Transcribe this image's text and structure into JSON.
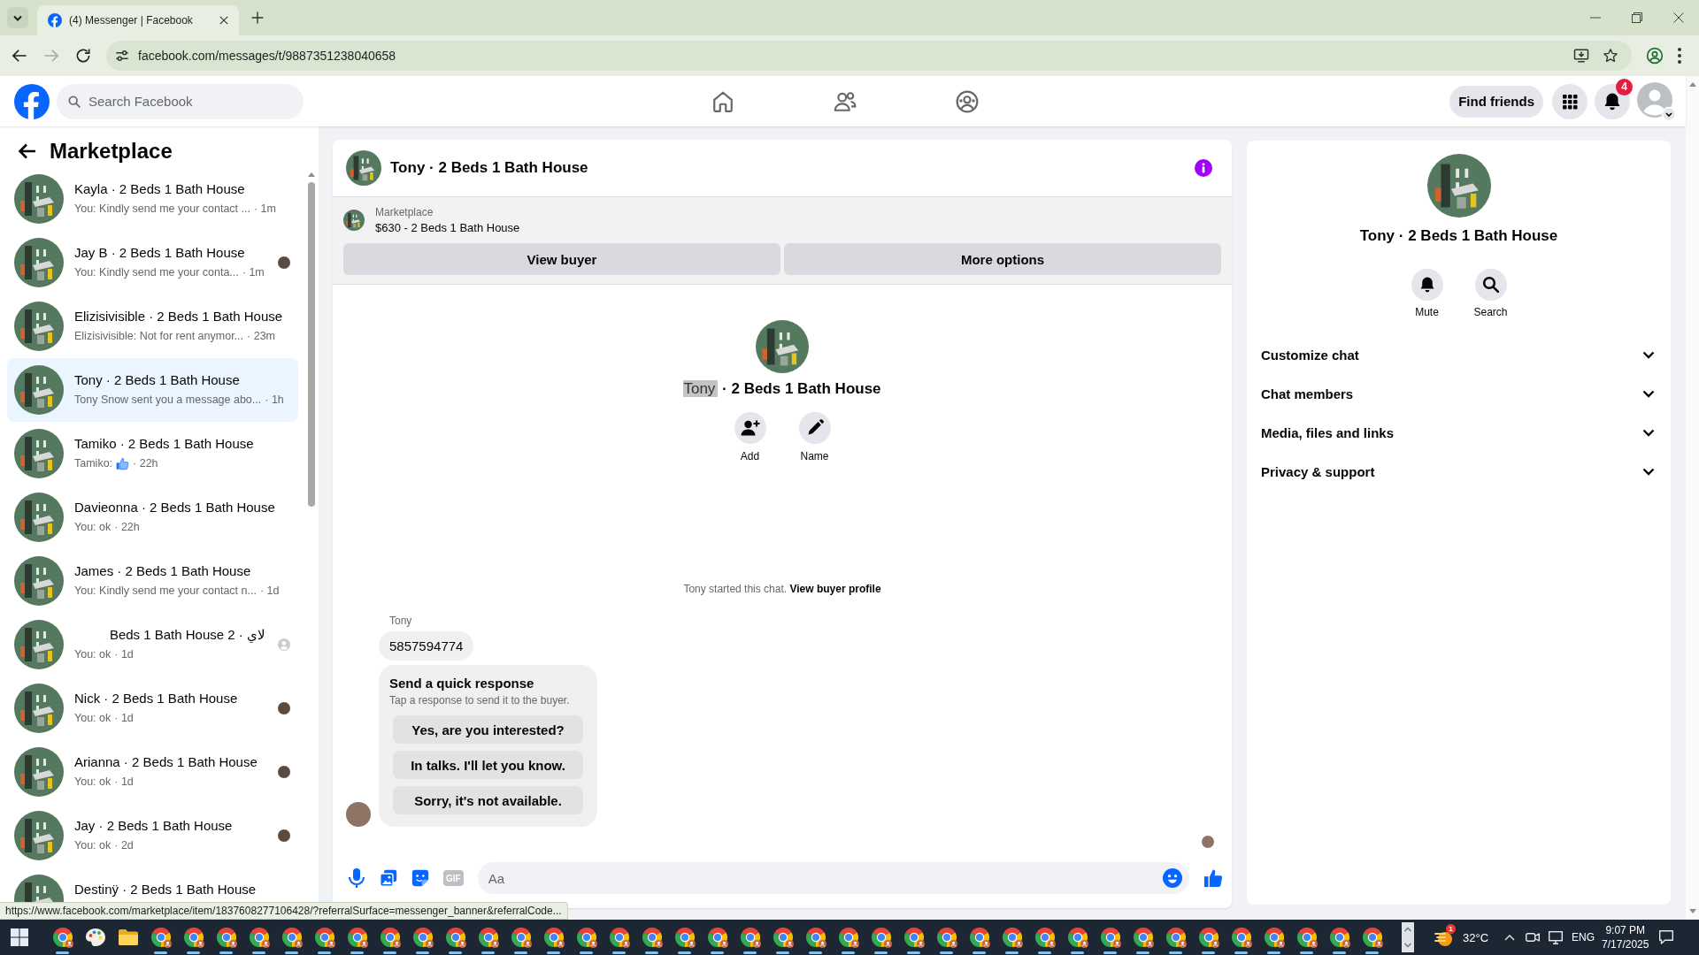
{
  "browser": {
    "tabs": [
      {
        "title": "(4) Messenger | Facebook",
        "selected": true
      }
    ],
    "nav_buttons": [
      {
        "kind": "back",
        "disabled": false
      },
      {
        "kind": "forward",
        "disabled": true
      },
      {
        "kind": "reload",
        "disabled": false
      }
    ],
    "url": "facebook.com/messages/t/9887351238040658",
    "status_url": "https://www.facebook.com/marketplace/item/1837608277106428/?referralSurface=messenger_banner&referralCode..."
  },
  "header": {
    "search": {
      "placeholder": "Search Facebook"
    },
    "nav": [
      {
        "kind": "home",
        "selected": false
      },
      {
        "kind": "friends",
        "selected": false
      },
      {
        "kind": "groups",
        "selected": false
      }
    ],
    "find_friends": "Find friends",
    "notification_count": "4"
  },
  "sidebar": {
    "title": "Marketplace",
    "conversations": [
      {
        "name": "Kayla · 2 Beds 1 Bath House",
        "kind": "text",
        "preview": "You: Kindly send me your contact ...",
        "time": "· 1m",
        "selected": false
      },
      {
        "name": "Jay B · 2 Beds 1 Bath House",
        "kind": "text",
        "preview": "You: Kindly send me your conta...",
        "time": "· 1m",
        "selected": false,
        "receipt": {
          "kind": "photo"
        }
      },
      {
        "name": "Elizisivisible · 2 Beds 1 Bath House",
        "kind": "text",
        "preview": "Elizisivisible: Not for rent anymor...",
        "time": "· 23m",
        "selected": false
      },
      {
        "name": "Tony · 2 Beds 1 Bath House",
        "kind": "text",
        "preview": "Tony Snow sent you a message abo...",
        "time": "· 1h",
        "selected": true
      },
      {
        "name": "Tamiko · 2 Beds 1 Bath House",
        "kind": "like",
        "preview": "Tamiko:",
        "time": "· 22h",
        "selected": false
      },
      {
        "name": "Davieonna · 2 Beds 1 Bath House",
        "kind": "text",
        "preview": "You: ok",
        "time": "· 22h",
        "selected": false
      },
      {
        "name": "James · 2 Beds 1 Bath House",
        "kind": "text",
        "preview": "You: Kindly send me your contact n...",
        "time": "· 1d",
        "selected": false
      },
      {
        "name": "لاي · 2 Beds 1 Bath House",
        "kind": "text",
        "preview": "You: ok",
        "time": "· 1d",
        "selected": false,
        "receipt": {
          "kind": "silhouette"
        }
      },
      {
        "name": "Nick · 2 Beds 1 Bath House",
        "kind": "text",
        "preview": "You: ok",
        "time": "· 1d",
        "selected": false,
        "receipt": {
          "kind": "photo"
        }
      },
      {
        "name": "Arianna · 2 Beds 1 Bath House",
        "kind": "text",
        "preview": "You: ok",
        "time": "· 1d",
        "selected": false,
        "receipt": {
          "kind": "photo"
        }
      },
      {
        "name": "Jay · 2 Beds 1 Bath House",
        "kind": "text",
        "preview": "You: ok",
        "time": "· 2d",
        "selected": false,
        "receipt": {
          "kind": "photo"
        }
      },
      {
        "name": "Destinÿ · 2 Beds 1 Bath House",
        "kind": "text",
        "selected": false
      }
    ]
  },
  "chat": {
    "title": "Tony · 2 Beds 1 Bath House",
    "listing": {
      "label": "Marketplace",
      "title": "$630 - 2 Beds 1 Bath House",
      "buttons": [
        "View buyer",
        "More options"
      ]
    },
    "profile": {
      "title_parts": [
        {
          "text": "Tony",
          "selected": true
        },
        {
          "text": "· 2 Beds 1 Bath House",
          "selected": false
        }
      ],
      "actions": [
        {
          "kind": "add",
          "label": "Add"
        },
        {
          "kind": "name",
          "label": "Name"
        }
      ]
    },
    "notice": {
      "text": "Tony started this chat.",
      "link": "View buyer profile"
    },
    "messages": [
      {
        "sender": "Tony",
        "text": "5857594774"
      }
    ],
    "quick_response": {
      "title": "Send a quick response",
      "subtitle": "Tap a response to send it to the buyer.",
      "options": [
        "Yes, are you interested?",
        "In talks. I'll let you know.",
        "Sorry, it's not available."
      ]
    },
    "composer": {
      "gif_label": "GIF",
      "placeholder": "Aa"
    }
  },
  "details": {
    "title": "Tony · 2 Beds 1 Bath House",
    "actions": [
      {
        "kind": "mute",
        "label": "Mute"
      },
      {
        "kind": "search",
        "label": "Search"
      }
    ],
    "sections": [
      {
        "label": "Customize chat",
        "expanded": false
      },
      {
        "label": "Chat members",
        "expanded": false
      },
      {
        "label": "Media, files and links",
        "expanded": false
      },
      {
        "label": "Privacy & support",
        "expanded": false
      }
    ]
  },
  "taskbar": {
    "apps": [
      {
        "kind": "browser",
        "running": true
      },
      {
        "kind": "palette",
        "running": false
      },
      {
        "kind": "folder",
        "running": false
      },
      {
        "kind": "browser",
        "running": true
      },
      {
        "kind": "browser",
        "running": true
      },
      {
        "kind": "browser",
        "running": true
      },
      {
        "kind": "browser",
        "running": true
      },
      {
        "kind": "browser",
        "running": true
      },
      {
        "kind": "browser",
        "running": true
      },
      {
        "kind": "browser",
        "running": true
      },
      {
        "kind": "browser",
        "running": true
      },
      {
        "kind": "browser",
        "running": true
      },
      {
        "kind": "browser",
        "running": true
      },
      {
        "kind": "browser",
        "running": true
      },
      {
        "kind": "browser",
        "running": true
      },
      {
        "kind": "browser",
        "running": true
      },
      {
        "kind": "browser",
        "running": true
      },
      {
        "kind": "browser",
        "running": true
      },
      {
        "kind": "browser",
        "running": true
      },
      {
        "kind": "browser",
        "running": true
      },
      {
        "kind": "browser",
        "running": true
      },
      {
        "kind": "browser",
        "running": true
      },
      {
        "kind": "browser",
        "running": true
      },
      {
        "kind": "browser",
        "running": true
      },
      {
        "kind": "browser",
        "running": true
      },
      {
        "kind": "browser",
        "running": true
      },
      {
        "kind": "browser",
        "running": true
      },
      {
        "kind": "browser",
        "running": true
      },
      {
        "kind": "browser",
        "running": true
      },
      {
        "kind": "browser",
        "running": true
      },
      {
        "kind": "browser",
        "running": true
      },
      {
        "kind": "browser",
        "running": true
      },
      {
        "kind": "browser",
        "running": true
      },
      {
        "kind": "browser",
        "running": true
      },
      {
        "kind": "browser",
        "running": true
      },
      {
        "kind": "browser",
        "running": true
      },
      {
        "kind": "browser",
        "running": true
      },
      {
        "kind": "browser",
        "running": true
      },
      {
        "kind": "browser",
        "running": true
      },
      {
        "kind": "browser",
        "running": true
      },
      {
        "kind": "browser",
        "running": true
      }
    ],
    "weather_badge": "1",
    "temperature": "32°C",
    "language": "ENG",
    "time": "9:07 PM",
    "date": "7/17/2025"
  }
}
